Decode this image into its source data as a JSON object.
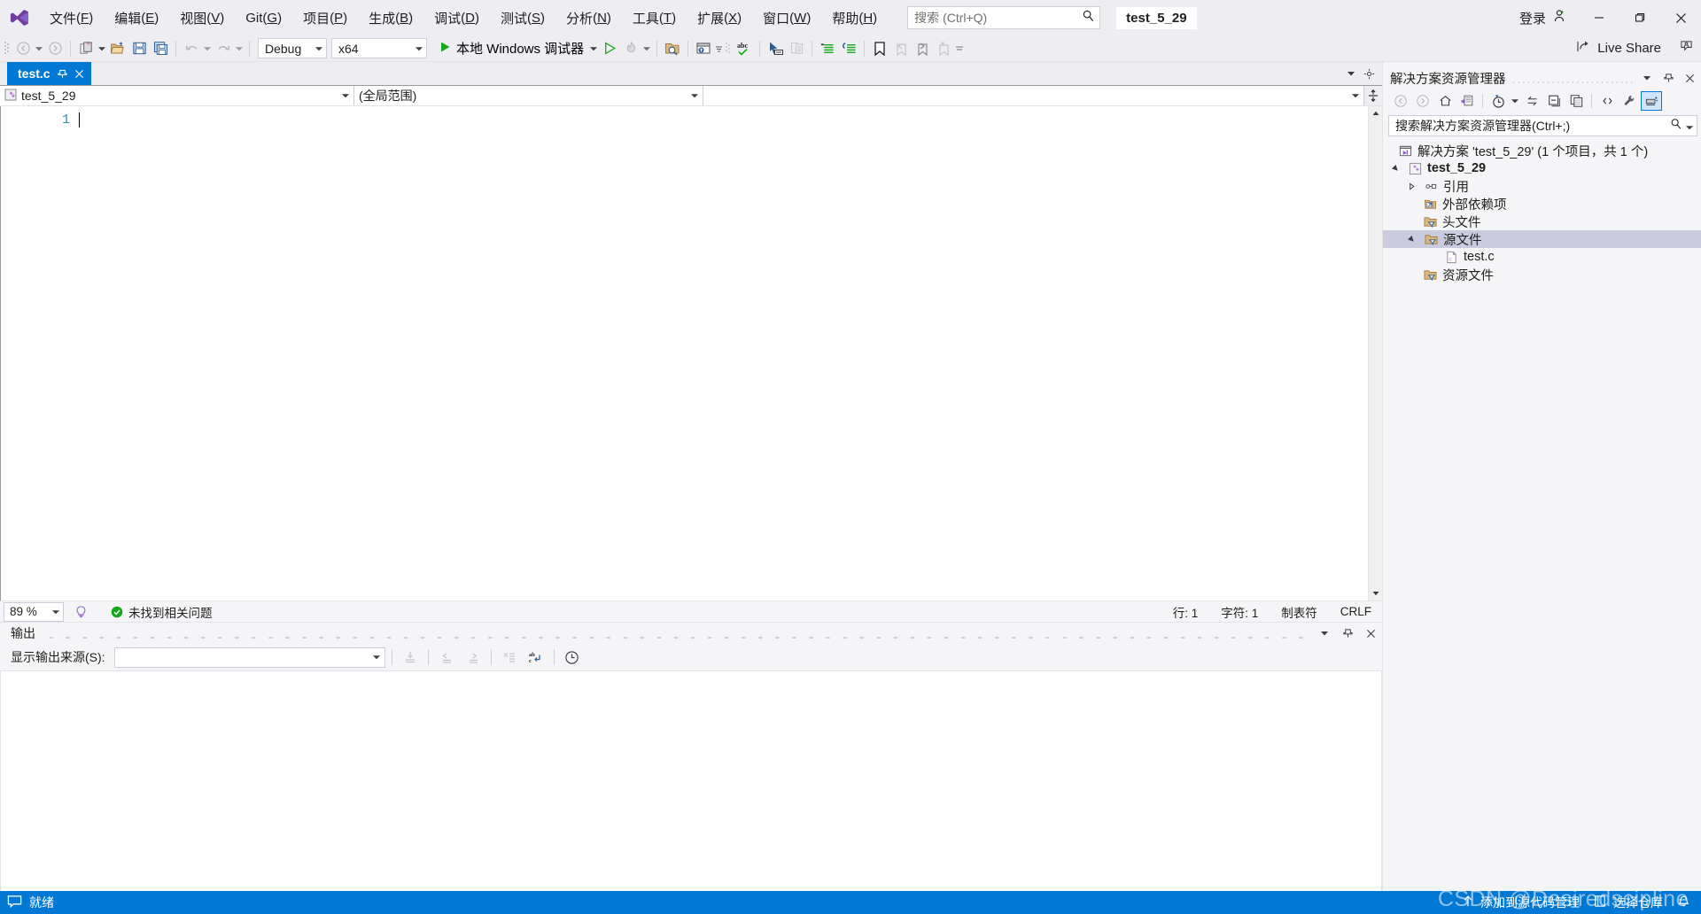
{
  "titlebar": {
    "logo_name": "visual-studio-logo",
    "menus": [
      {
        "label": "文件",
        "accel": "F"
      },
      {
        "label": "编辑",
        "accel": "E"
      },
      {
        "label": "视图",
        "accel": "V"
      },
      {
        "label": "Git",
        "accel": "G"
      },
      {
        "label": "项目",
        "accel": "P"
      },
      {
        "label": "生成",
        "accel": "B"
      },
      {
        "label": "调试",
        "accel": "D"
      },
      {
        "label": "测试",
        "accel": "S"
      },
      {
        "label": "分析",
        "accel": "N"
      },
      {
        "label": "工具",
        "accel": "T"
      },
      {
        "label": "扩展",
        "accel": "X"
      },
      {
        "label": "窗口",
        "accel": "W"
      },
      {
        "label": "帮助",
        "accel": "H"
      }
    ],
    "search_placeholder": "搜索 (Ctrl+Q)",
    "search_value": "",
    "solution_chip": "test_5_29",
    "signin_label": "登录",
    "minimize_icon": "minimize-icon",
    "restore_icon": "restore-icon",
    "close_icon": "close-icon"
  },
  "toolbar": {
    "back_icon": "navigate-back-icon",
    "forward_icon": "navigate-forward-icon",
    "new_project_icon": "new-project-icon",
    "open_file_icon": "open-file-icon",
    "save_icon": "save-icon",
    "save_all_icon": "save-all-icon",
    "undo_icon": "undo-icon",
    "redo_icon": "redo-icon",
    "configuration": "Debug",
    "platform": "x64",
    "run_label": "本地 Windows 调试器",
    "run_play_icon": "play-icon",
    "start_no_debug_icon": "start-without-debugging-icon",
    "hot_reload_icon": "hot-reload-icon",
    "find_in_files_icon": "find-in-files-icon",
    "window_layout_icon": "window-layout-icon",
    "spell_check_icon": "spell-check-icon",
    "pointer_icon": "selection-pointer-icon",
    "paste_list_icon": "clipboard-history-icon",
    "comment_icon": "comment-lines-icon",
    "uncomment_icon": "uncomment-lines-icon",
    "indent_icon": "indent-icon",
    "bookmark_icon": "bookmark-icon",
    "prev_bookmark_icon": "previous-bookmark-icon",
    "next_bookmark_icon": "next-bookmark-icon",
    "clear_bookmark_icon": "clear-bookmarks-icon",
    "overflow_icon": "toolbar-overflow-icon",
    "live_share_label": "Live Share",
    "live_share_icon": "live-share-icon",
    "live_share_user_icon": "live-share-user-icon"
  },
  "editor": {
    "tab_label": "test.c",
    "tab_pin_icon": "pin-icon",
    "tab_close_icon": "close-tab-icon",
    "tabstrip_chevron_icon": "tab-list-chevron-icon",
    "tabstrip_settings_icon": "tabstrip-settings-icon",
    "nav_project": "test_5_29",
    "nav_project_icon": "cpp-project-icon",
    "nav_scope": "(全局范围)",
    "nav_member": "",
    "nav_split_icon": "split-window-icon",
    "line_numbers": [
      "1"
    ],
    "content_lines": [
      ""
    ],
    "zoom_level": "89 %",
    "assistant_icon": "intellicode-icon",
    "issues_icon": "no-issues-icon",
    "issues_text": "未找到相关问题",
    "status_line_label": "行: 1",
    "status_char_label": "字符: 1",
    "status_tabs_label": "制表符",
    "status_eol_label": "CRLF",
    "scroll_up_icon": "scroll-up-icon",
    "scroll_down_icon": "scroll-down-icon"
  },
  "output": {
    "title": "输出",
    "chevron_icon": "pane-chevron-icon",
    "pin_icon": "pane-pin-icon",
    "close_icon": "pane-close-icon",
    "source_label": "显示输出来源(S):",
    "source_value": "",
    "find_message_icon": "find-message-icon",
    "go_prev_icon": "go-to-previous-message-icon",
    "go_next_icon": "go-to-next-message-icon",
    "clear_all_icon": "clear-all-icon",
    "word_wrap_icon": "toggle-word-wrap-icon",
    "timestamp_icon": "show-timestamps-icon",
    "body_text": ""
  },
  "solution_explorer": {
    "title": "解决方案资源管理器",
    "chevron_icon": "pane-chevron-icon",
    "pin_icon": "pane-pin-icon",
    "close_icon": "pane-close-icon",
    "toolbar": {
      "back_icon": "se-back-icon",
      "forward_icon": "se-forward-icon",
      "home_icon": "se-home-icon",
      "pending_changes_icon": "se-pending-changes-icon",
      "history_icon": "se-history-icon",
      "history_caret_icon": "se-history-caret-icon",
      "sync_icon": "se-sync-with-active-document-icon",
      "collapse_all_icon": "se-collapse-all-icon",
      "properties_window_icon": "se-properties-window-icon",
      "show_all_files_icon": "se-show-all-files-icon",
      "properties_icon": "se-properties-icon",
      "preview_icon": "se-preview-selected-items-icon"
    },
    "search_placeholder": "搜索解决方案资源管理器(Ctrl+;)",
    "search_value": "",
    "search_icon": "se-search-icon",
    "search_caret_icon": "se-search-caret-icon",
    "tree": [
      {
        "label": "解决方案 'test_5_29' (1 个项目，共 1 个)",
        "icon": "solution-icon",
        "indent": 0,
        "expander": "none",
        "bold": false,
        "selected": false
      },
      {
        "label": "test_5_29",
        "icon": "cpp-project-icon",
        "indent": 1,
        "expander": "expanded",
        "bold": true,
        "selected": false
      },
      {
        "label": "引用",
        "icon": "references-icon",
        "indent": 2,
        "expander": "collapsed",
        "bold": false,
        "selected": false
      },
      {
        "label": "外部依赖项",
        "icon": "external-dependencies-icon",
        "indent": 3,
        "expander": "none",
        "bold": false,
        "selected": false
      },
      {
        "label": "头文件",
        "icon": "filter-folder-icon",
        "indent": 3,
        "expander": "none",
        "bold": false,
        "selected": false
      },
      {
        "label": "源文件",
        "icon": "filter-folder-icon",
        "indent": 2,
        "expander": "expanded",
        "bold": false,
        "selected": true
      },
      {
        "label": "test.c",
        "icon": "c-file-icon",
        "indent": 4,
        "expander": "none",
        "bold": false,
        "selected": false
      },
      {
        "label": "资源文件",
        "icon": "filter-folder-icon",
        "indent": 3,
        "expander": "none",
        "bold": false,
        "selected": false
      }
    ]
  },
  "statusbar": {
    "ready_icon": "ready-balloon-icon",
    "ready_text": "就绪",
    "add_source_control_icon": "add-to-source-control-arrow-icon",
    "add_source_control_text": "添加到源代码管理",
    "select_repo_icon": "select-repository-icon",
    "select_repo_text": "选择仓库",
    "notifications_icon": "notifications-bell-icon"
  },
  "watermark": {
    "text": "CSDN @Desiredscipline"
  }
}
